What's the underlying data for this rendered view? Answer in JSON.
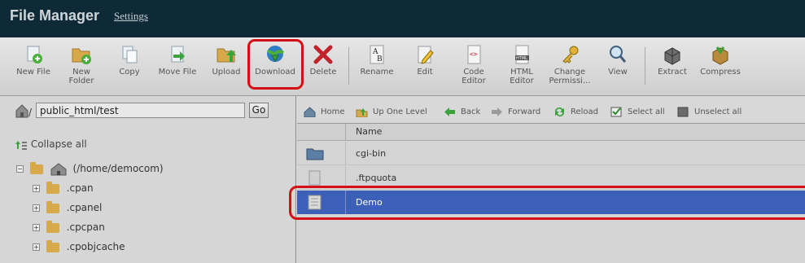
{
  "header": {
    "title": "File Manager",
    "settings_link": "Settings"
  },
  "toolbar": {
    "buttons": [
      {
        "label": "New File",
        "icon": "new-file-icon"
      },
      {
        "label": "New Folder",
        "icon": "new-folder-icon"
      },
      {
        "label": "Copy",
        "icon": "copy-icon"
      },
      {
        "label": "Move File",
        "icon": "move-file-icon"
      },
      {
        "label": "Upload",
        "icon": "upload-icon"
      },
      {
        "label": "Download",
        "icon": "download-icon"
      },
      {
        "label": "Delete",
        "icon": "delete-icon"
      },
      {
        "label": "Rename",
        "icon": "rename-icon"
      },
      {
        "label": "Edit",
        "icon": "edit-icon"
      },
      {
        "label": "Code Editor",
        "icon": "code-editor-icon"
      },
      {
        "label": "HTML Editor",
        "icon": "html-editor-icon"
      },
      {
        "label": "Change Permissi...",
        "icon": "key-icon"
      },
      {
        "label": "View",
        "icon": "view-icon"
      },
      {
        "label": "Extract",
        "icon": "extract-icon"
      },
      {
        "label": "Compress",
        "icon": "compress-icon"
      }
    ]
  },
  "left": {
    "path_value": "public_html/test",
    "go_label": "Go",
    "collapse_label": "Collapse all",
    "root_label": "(/home/democom)",
    "tree": [
      ".cpan",
      ".cpanel",
      ".cpcpan",
      ".cpobjcache"
    ]
  },
  "nav": {
    "home": "Home",
    "up": "Up One Level",
    "back": "Back",
    "forward": "Forward",
    "reload": "Reload",
    "select_all": "Select all",
    "unselect_all": "Unselect all"
  },
  "grid": {
    "header_name": "Name",
    "rows": [
      {
        "name": "cgi-bin",
        "type": "folder"
      },
      {
        "name": ".ftpquota",
        "type": "file"
      },
      {
        "name": "Demo",
        "type": "file",
        "selected": true
      }
    ]
  },
  "colors": {
    "header": "#0f2a37",
    "selection": "#3c5fb8",
    "highlight": "#d40f15"
  }
}
